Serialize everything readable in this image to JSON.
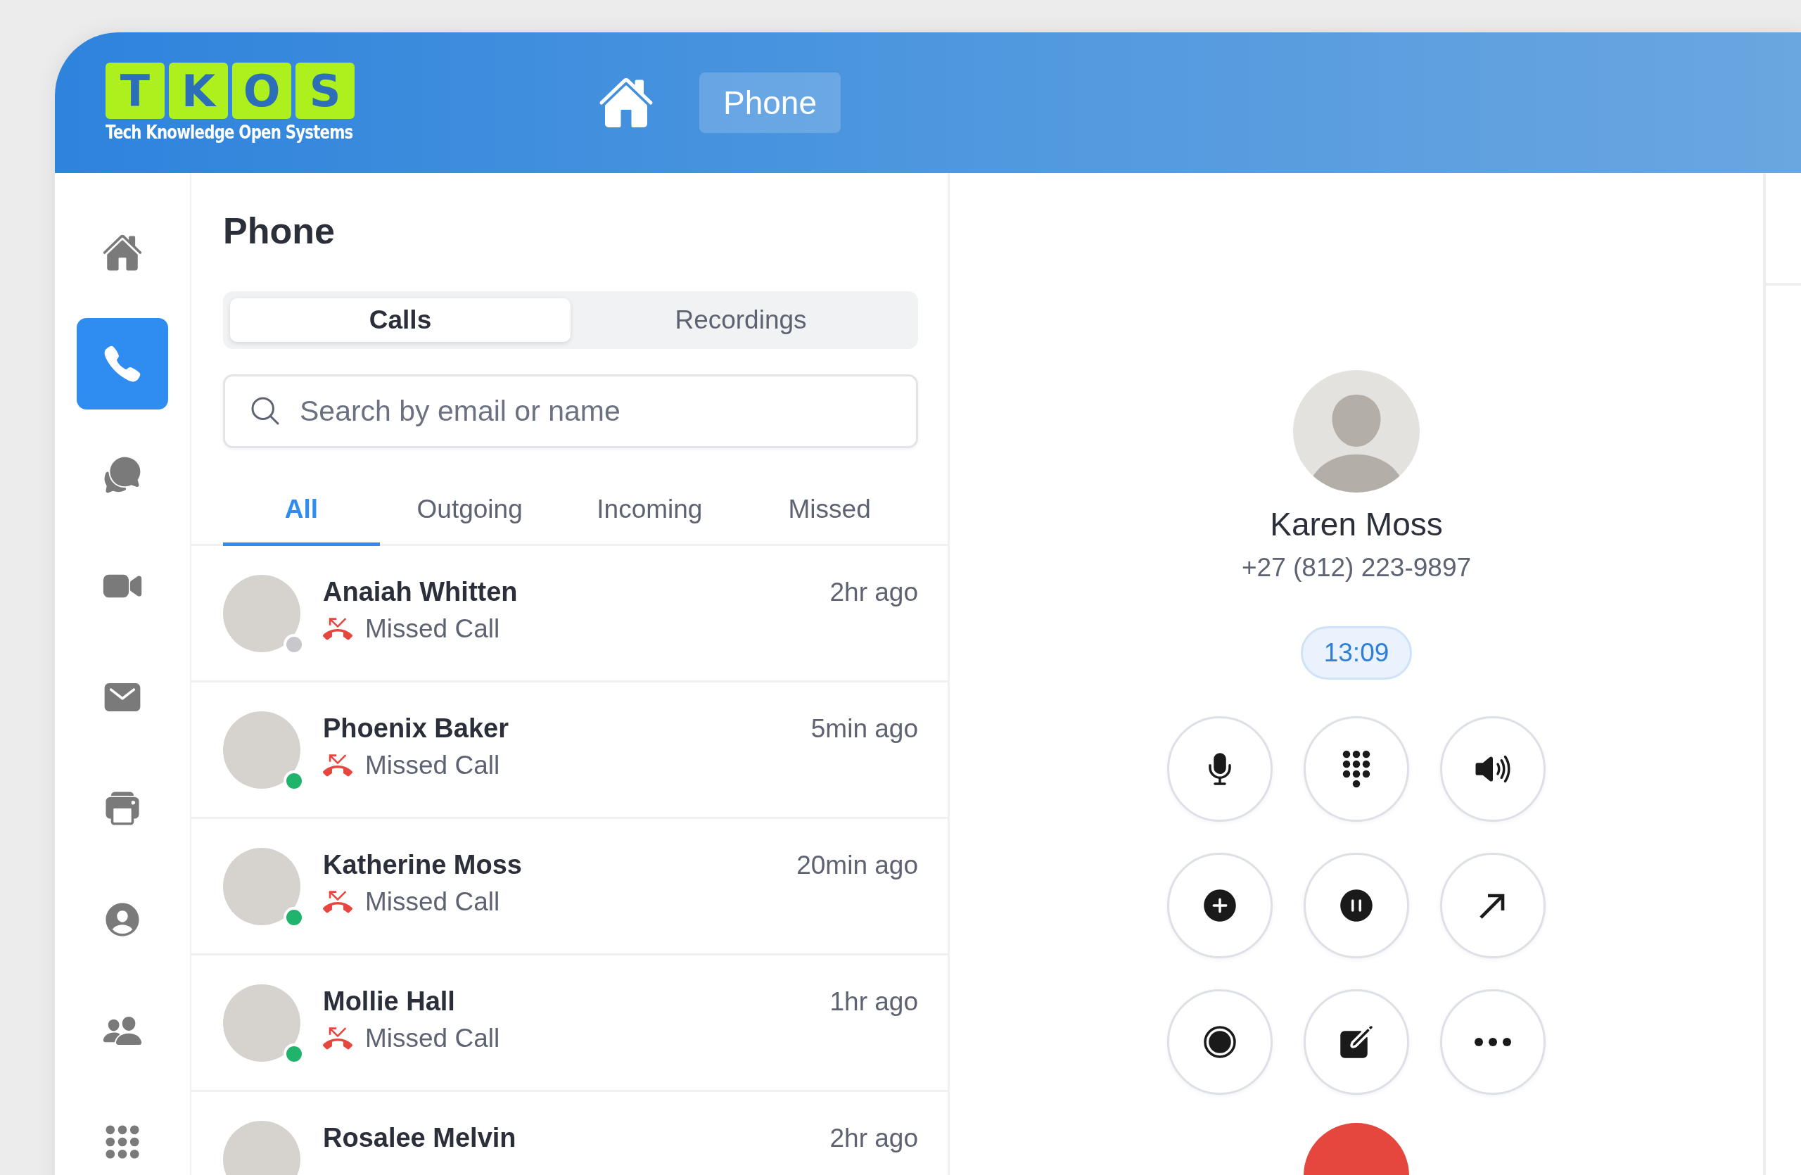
{
  "header": {
    "logo": {
      "letters": [
        "T",
        "K",
        "O",
        "S"
      ],
      "tagline": "Tech Knowledge Open Systems"
    },
    "nav": [
      {
        "kind": "home"
      },
      {
        "kind": "text",
        "label": "Phone"
      }
    ]
  },
  "sidebar": {
    "items": [
      {
        "kind": "home",
        "selected": false
      },
      {
        "kind": "phone",
        "selected": true
      },
      {
        "kind": "chat",
        "selected": false
      },
      {
        "kind": "video",
        "selected": false
      },
      {
        "kind": "mail",
        "selected": false
      },
      {
        "kind": "printer",
        "selected": false
      },
      {
        "kind": "user",
        "selected": false
      },
      {
        "kind": "group",
        "selected": false
      },
      {
        "kind": "apps",
        "selected": false
      }
    ]
  },
  "list_panel": {
    "title": "Phone",
    "segments": [
      {
        "label": "Calls",
        "selected": true
      },
      {
        "label": "Recordings",
        "selected": false
      }
    ],
    "search": {
      "placeholder": "Search by email or name"
    },
    "filters": [
      {
        "label": "All",
        "selected": true
      },
      {
        "label": "Outgoing",
        "selected": false
      },
      {
        "label": "Incoming",
        "selected": false
      },
      {
        "label": "Missed",
        "selected": false
      }
    ],
    "calls": [
      {
        "name": "Anaiah Whitten",
        "status": "Missed Call",
        "time": "2hr ago",
        "color": "#c8c8cc"
      },
      {
        "name": "Phoenix Baker",
        "status": "Missed Call",
        "time": "5min ago",
        "color": "#1fb36b"
      },
      {
        "name": "Katherine Moss",
        "status": "Missed Call",
        "time": "20min ago",
        "color": "#1fb36b"
      },
      {
        "name": "Mollie Hall",
        "status": "Missed Call",
        "time": "1hr ago",
        "color": "#1fb36b"
      },
      {
        "name": "Rosalee Melvin",
        "time": "2hr ago"
      }
    ]
  },
  "active_call": {
    "name": "Karen Moss",
    "phone": "+27 (812) 223-9897",
    "timer": "13:09",
    "controls": [
      {
        "kind": "mic"
      },
      {
        "kind": "keypad"
      },
      {
        "kind": "speaker"
      },
      {
        "kind": "add"
      },
      {
        "kind": "pause"
      },
      {
        "kind": "transfer"
      },
      {
        "kind": "record"
      },
      {
        "kind": "note"
      },
      {
        "kind": "more"
      }
    ]
  }
}
